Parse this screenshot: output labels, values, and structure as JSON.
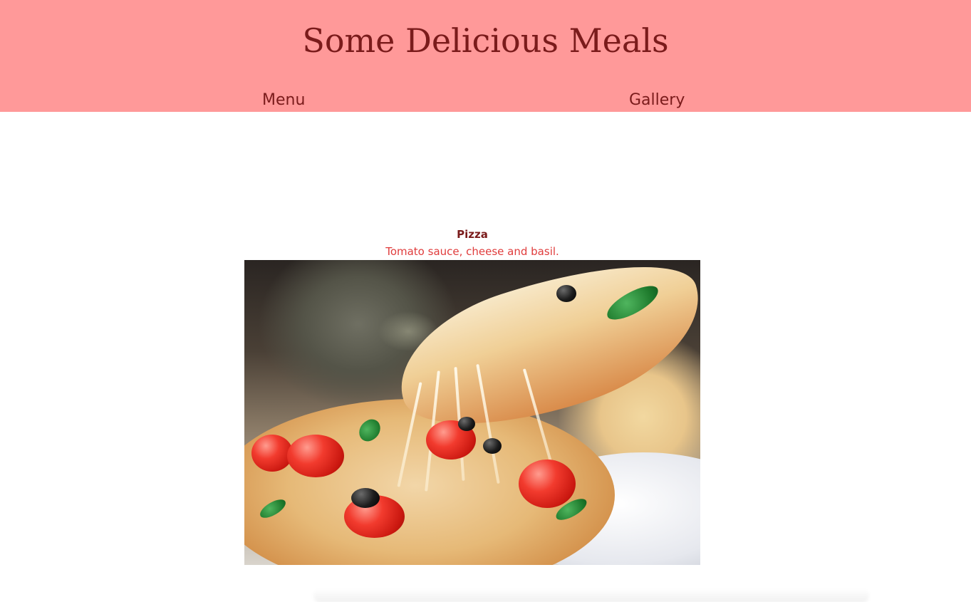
{
  "header": {
    "title": "Some Delicious Meals",
    "nav": [
      {
        "label": "Menu"
      },
      {
        "label": "Gallery"
      }
    ]
  },
  "item": {
    "name": "Pizza",
    "description": "Tomato sauce, cheese and basil."
  },
  "colors": {
    "header_bg": "#ff9999",
    "title_text": "#7a1b1b",
    "description_text": "#e03c3c"
  },
  "icons": {
    "photo": "pizza-photo"
  }
}
